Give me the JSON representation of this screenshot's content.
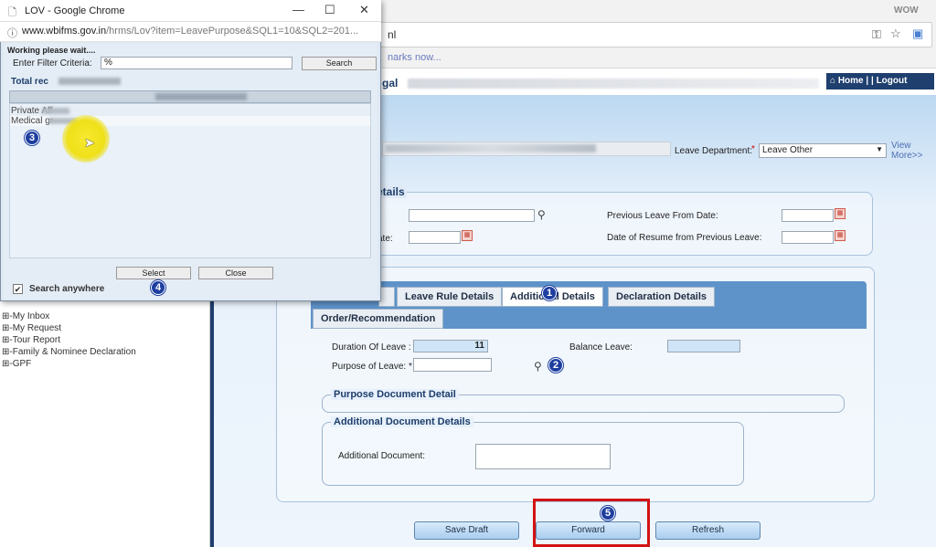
{
  "browser": {
    "url_suffix": "nl",
    "bookmarks_text": "narks now...",
    "badge": "WOW"
  },
  "header": {
    "title": "gal",
    "home": "Home",
    "logout": "Logout"
  },
  "left_menu": {
    "items": [
      {
        "label": "-My Inbox"
      },
      {
        "label": "-My Request"
      },
      {
        "label": "-Tour Report"
      },
      {
        "label": "-Family & Nominee Declaration"
      },
      {
        "label": "-GPF"
      }
    ]
  },
  "employee_row": {
    "leave_department_label": "Leave Department:",
    "leave_department_value": "Leave Other",
    "view_more": "View More>>"
  },
  "previous_leave": {
    "legend": "etails",
    "label_ate": "ate:",
    "previous_leave_from_label": "Previous Leave From Date:",
    "resume_label": "Date of Resume from Previous Leave:"
  },
  "tabs": [
    {
      "label": "Leave Rule Details"
    },
    {
      "label": "Additional Details"
    },
    {
      "label": "Declaration Details"
    },
    {
      "label": "Order/Recommendation"
    }
  ],
  "form": {
    "duration_label": "Duration Of Leave :",
    "duration_value": "11",
    "balance_label": "Balance Leave:",
    "purpose_label": "Purpose of Leave: *",
    "purpose_doc_legend": "Purpose Document Detail",
    "additional_doc_legend": "Additional Document Details",
    "additional_doc_label": "Additional Document:"
  },
  "buttons": {
    "save_draft": "Save Draft",
    "forward": "Forward",
    "refresh": "Refresh"
  },
  "markers": {
    "m1": "1",
    "m2": "2",
    "m3": "3",
    "m4": "4",
    "m5": "5"
  },
  "popup": {
    "title": "LOV - Google Chrome",
    "url_host": "www.wbifms.gov.in",
    "url_path": "/hrms/Lov?item=LeavePurpose&SQL1=10&SQL2=201...",
    "working_text": "Working please wait....",
    "filter_label": "Enter Filter Criteria:",
    "filter_value": "%",
    "search_button": "Search",
    "total_label": "Total rec",
    "rows": [
      {
        "label": "Private Aff"
      },
      {
        "label": "Medical gr"
      }
    ],
    "select_button": "Select",
    "close_button": "Close",
    "search_anywhere_label": "Search anywhere",
    "search_anywhere_checked": true
  },
  "colors": {
    "header_navy": "#1f3f6e",
    "tab_bar_blue": "#5e93c9",
    "marker_blue": "#1e3fa0",
    "highlight_red": "#d31313",
    "cursor_yellow": "#efe019"
  }
}
